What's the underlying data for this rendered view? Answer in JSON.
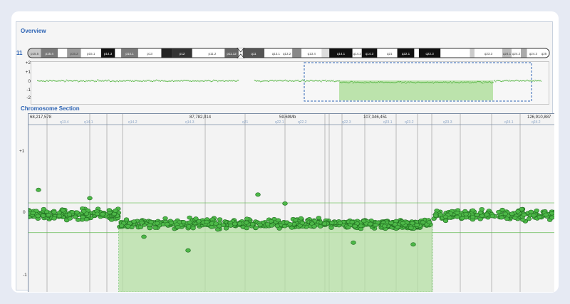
{
  "overview": {
    "title": "Overview",
    "chromosome": "11",
    "bands": [
      {
        "label": "p15.5",
        "c": "#c8c8c8",
        "w": 16
      },
      {
        "label": "p15.4",
        "c": "#7a7a7a",
        "w": 22
      },
      {
        "label": "",
        "c": "#ffffff",
        "w": 12
      },
      {
        "label": "p15.2",
        "c": "#9a9a9a",
        "w": 18
      },
      {
        "label": "p15.1",
        "c": "#ffffff",
        "w": 26
      },
      {
        "label": "p14.3",
        "c": "#111111",
        "w": 18
      },
      {
        "label": "",
        "c": "#ffffff",
        "w": 8
      },
      {
        "label": "p14.1",
        "c": "#7a7a7a",
        "w": 22
      },
      {
        "label": "p13",
        "c": "#ffffff",
        "w": 30
      },
      {
        "label": "",
        "c": "#222222",
        "w": 14
      },
      {
        "label": "p12",
        "c": "#333333",
        "w": 26
      },
      {
        "label": "",
        "c": "#ffffff",
        "w": 10
      },
      {
        "label": "p11.2",
        "c": "#ffffff",
        "w": 32
      },
      {
        "label": "p11.12",
        "c": "#666666",
        "w": 18
      },
      {
        "label": "q11",
        "c": "#555555",
        "w": 28
      },
      {
        "label": "",
        "c": "#ffffff",
        "w": 8
      },
      {
        "label": "q13.1",
        "c": "#ffffff",
        "w": 14
      },
      {
        "label": "q13.2",
        "c": "#ffffff",
        "w": 14
      },
      {
        "label": "",
        "c": "#888888",
        "w": 12
      },
      {
        "label": "q13.4",
        "c": "#ffffff",
        "w": 26
      },
      {
        "label": "",
        "c": "#dddddd",
        "w": 10
      },
      {
        "label": "q14.1",
        "c": "#111111",
        "w": 30
      },
      {
        "label": "q14.2",
        "c": "#ffffff",
        "w": 12
      },
      {
        "label": "q14.3",
        "c": "#111111",
        "w": 20
      },
      {
        "label": "",
        "c": "#ffffff",
        "w": 6
      },
      {
        "label": "q21",
        "c": "#ffffff",
        "w": 20
      },
      {
        "label": "q22.1",
        "c": "#111111",
        "w": 22
      },
      {
        "label": "",
        "c": "#ffffff",
        "w": 6
      },
      {
        "label": "q22.3",
        "c": "#111111",
        "w": 28
      },
      {
        "label": "",
        "c": "#ffffff",
        "w": 24
      },
      {
        "label": "",
        "c": "#ffffff",
        "w": 14
      },
      {
        "label": "",
        "c": "#cccccc",
        "w": 6
      },
      {
        "label": "q23.3",
        "c": "#ffffff",
        "w": 36
      },
      {
        "label": "q24.1",
        "c": "#bbbbbb",
        "w": 12
      },
      {
        "label": "q24.2",
        "c": "#ffffff",
        "w": 12
      },
      {
        "label": "",
        "c": "#aaaaaa",
        "w": 8
      },
      {
        "label": "q24.3",
        "c": "#ffffff",
        "w": 16
      },
      {
        "label": "q25",
        "c": "#ffffff",
        "w": 12
      }
    ],
    "y_ticks": [
      "+2",
      "+1",
      "0",
      "-1",
      "-2"
    ]
  },
  "section": {
    "title": "Chromosome Section",
    "positions": [
      "68,217,578",
      "87,782,014",
      "59.69Mb",
      "107,346,451",
      "126,910,887"
    ],
    "band_labels": [
      "q13.4",
      "q14.1",
      "q14.2",
      "q14.3",
      "q21",
      "q22.1",
      "q22.2",
      "q22.3",
      "q23.1",
      "q23.2",
      "q23.3",
      "q24.1",
      "q24.2"
    ],
    "y_ticks": [
      "+1",
      "0",
      "-1"
    ]
  },
  "colors": {
    "accent": "#2c63b4",
    "point": "#4db848",
    "point_edge": "#1f6a1f",
    "highlight": "#b5e0a3"
  },
  "chart_data": {
    "type": "scatter",
    "title": "Chromosome Section",
    "xlabel": "",
    "ylabel": "",
    "xlim": [
      68217578,
      136910887
    ],
    "ylim": [
      -1.25,
      1.75
    ],
    "segments": [
      {
        "x0": 68217578,
        "x1": 80000000,
        "y": 0.05
      },
      {
        "x0": 80000000,
        "x1": 121000000,
        "y": -0.1
      },
      {
        "x0": 121000000,
        "x1": 136910887,
        "y": 0.05
      }
    ]
  }
}
